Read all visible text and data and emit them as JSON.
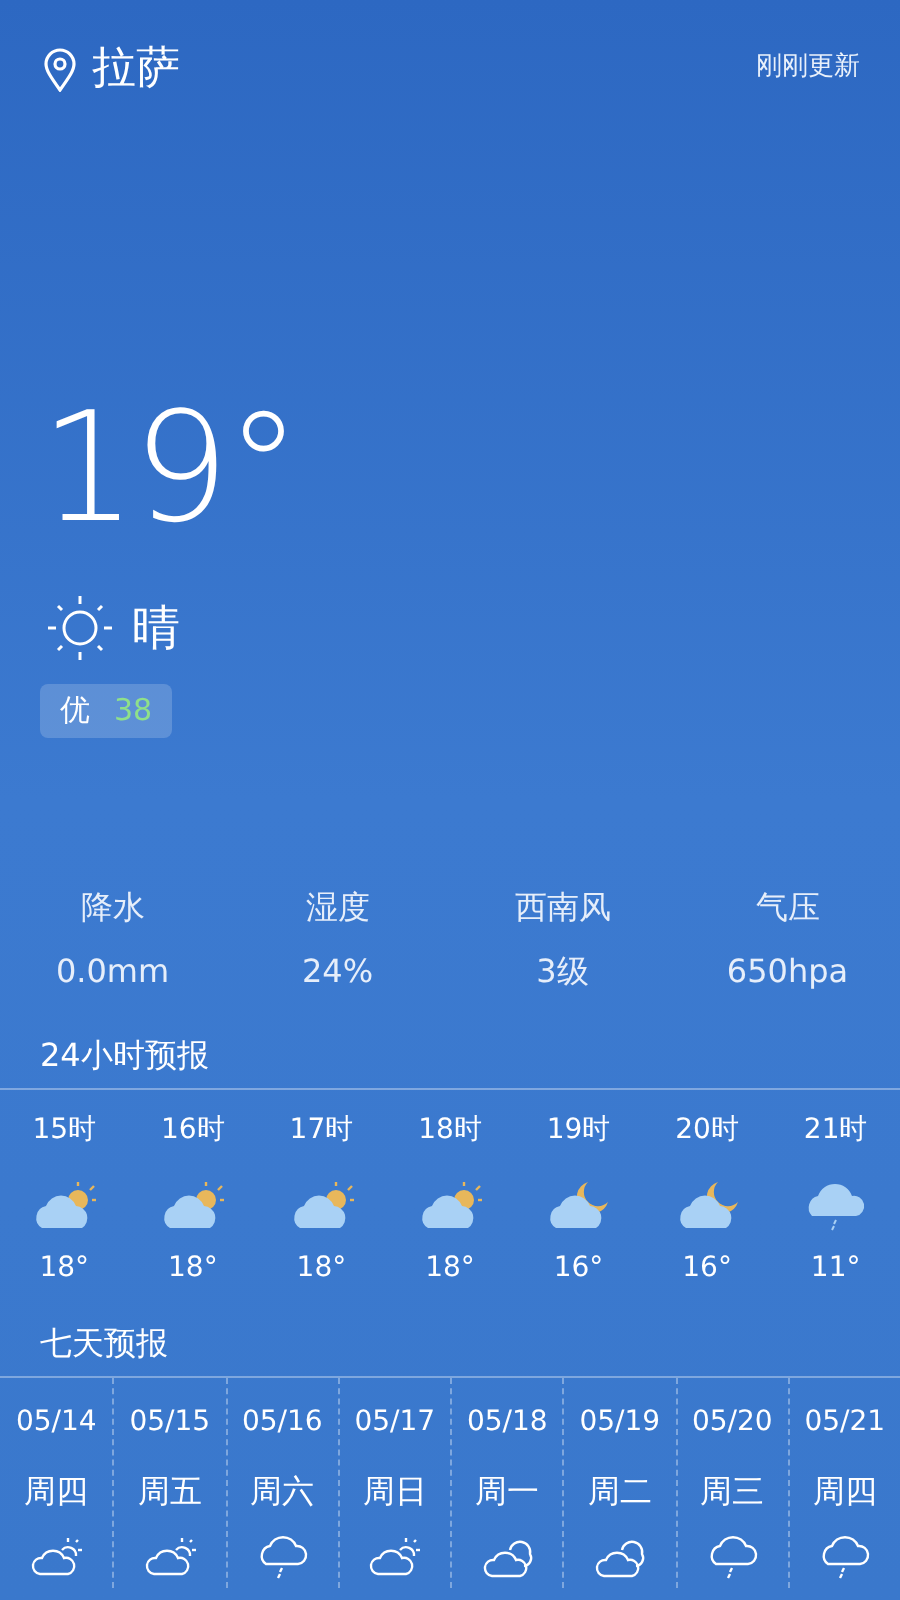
{
  "header": {
    "city": "拉萨",
    "updated": "刚刚更新"
  },
  "current": {
    "temperature": "19°",
    "condition": "晴",
    "aqi_label": "优",
    "aqi_value": "38"
  },
  "stats": [
    {
      "label": "降水",
      "value": "0.0mm"
    },
    {
      "label": "湿度",
      "value": "24%"
    },
    {
      "label": "西南风",
      "value": "3级"
    },
    {
      "label": "气压",
      "value": "650hpa"
    }
  ],
  "hourly_title": "24小时预报",
  "hourly": [
    {
      "time": "15时",
      "kind": "cloud-sun",
      "temp": "18°"
    },
    {
      "time": "16时",
      "kind": "cloud-sun",
      "temp": "18°"
    },
    {
      "time": "17时",
      "kind": "cloud-sun",
      "temp": "18°"
    },
    {
      "time": "18时",
      "kind": "cloud-sun",
      "temp": "18°"
    },
    {
      "time": "19时",
      "kind": "cloud-moon",
      "temp": "16°"
    },
    {
      "time": "20时",
      "kind": "cloud-moon",
      "temp": "16°"
    },
    {
      "time": "21时",
      "kind": "rain",
      "temp": "11°"
    }
  ],
  "daily_title": "七天预报",
  "daily": [
    {
      "date": "05/14",
      "weekday": "周四",
      "kind": "cloud-sun"
    },
    {
      "date": "05/15",
      "weekday": "周五",
      "kind": "cloud-sun"
    },
    {
      "date": "05/16",
      "weekday": "周六",
      "kind": "rain"
    },
    {
      "date": "05/17",
      "weekday": "周日",
      "kind": "cloud-sun"
    },
    {
      "date": "05/18",
      "weekday": "周一",
      "kind": "clouds"
    },
    {
      "date": "05/19",
      "weekday": "周二",
      "kind": "clouds"
    },
    {
      "date": "05/20",
      "weekday": "周三",
      "kind": "rain"
    },
    {
      "date": "05/21",
      "weekday": "周四",
      "kind": "rain"
    }
  ]
}
